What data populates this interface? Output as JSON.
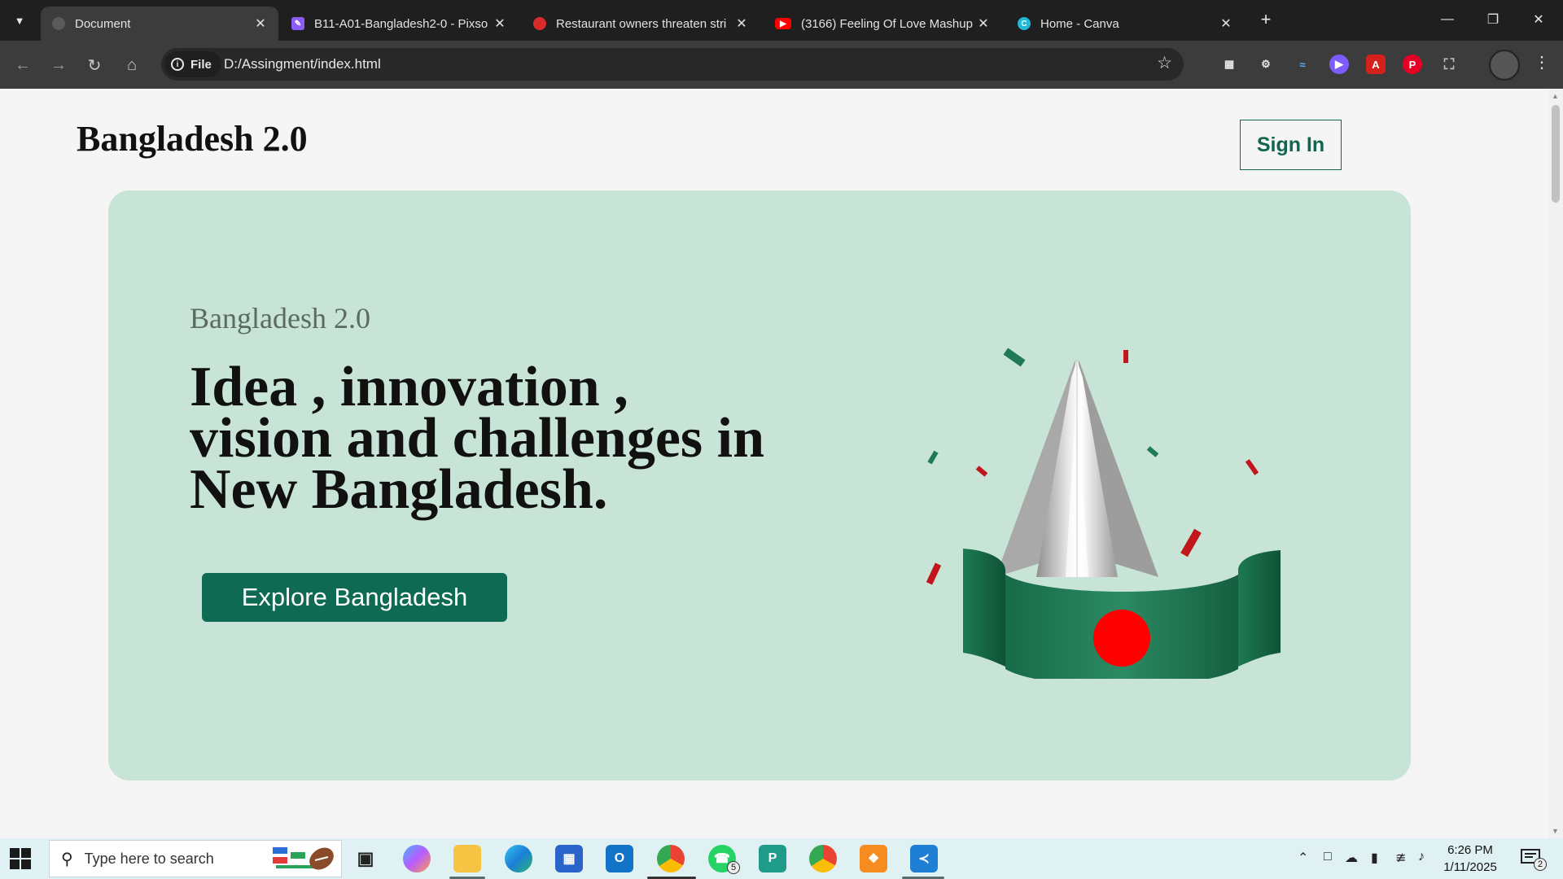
{
  "browser": {
    "tabs": [
      {
        "title": "Document",
        "active": true
      },
      {
        "title": "B11-A01-Bangladesh2-0 - Pixso",
        "active": false
      },
      {
        "title": "Restaurant owners threaten stri",
        "active": false
      },
      {
        "title": "(3166) Feeling Of Love Mashup",
        "active": false
      },
      {
        "title": "Home - Canva",
        "active": false
      }
    ],
    "url_chip": "File",
    "url": "D:/Assingment/index.html",
    "extension_icons": [
      "reading-list-icon",
      "extension-a-icon",
      "extension-wave-icon",
      "extension-play-icon",
      "acrobat-icon",
      "pinterest-icon",
      "extensions-puzzle-icon"
    ]
  },
  "page": {
    "brand": "Bangladesh 2.0",
    "signin_label": "Sign In",
    "hero": {
      "eyebrow": "Bangladesh 2.0",
      "headline": "Idea , innovation , vision and challenges in New Bangladesh.",
      "cta_label": "Explore Bangladesh"
    }
  },
  "taskbar": {
    "search_placeholder": "Type here to search",
    "apps": [
      "task-view-icon",
      "copilot-icon",
      "file-explorer-icon",
      "edge-icon",
      "store-icon",
      "outlook-icon",
      "chrome-icon",
      "whatsapp-icon",
      "pycharm-icon",
      "chrome-profile-icon",
      "xampp-icon",
      "vscode-icon"
    ],
    "whatsapp_badge": "5",
    "time": "6:26 PM",
    "date": "1/11/2025",
    "notification_count": "2"
  },
  "colors": {
    "accent": "#0e6a52",
    "hero_bg": "#c8e4d6",
    "flag_red": "#ff0000",
    "flag_green": "#1e7a55"
  }
}
